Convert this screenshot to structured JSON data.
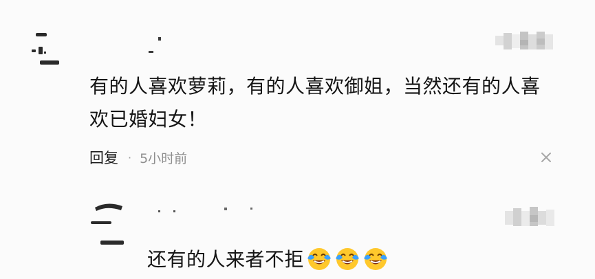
{
  "comments": [
    {
      "text": "有的人喜欢萝莉，有的人喜欢御姐，当然还有的人喜欢已婚妇女！",
      "reply_label": "回复",
      "separator": "·",
      "time": "5小时前"
    },
    {
      "text": "还有的人来者不拒",
      "emojis": [
        "laughing-crying-emoji",
        "laughing-crying-emoji",
        "laughing-crying-emoji"
      ]
    }
  ],
  "icons": {
    "close": "close-icon"
  },
  "colors": {
    "background": "#fbfbfb",
    "text": "#151515",
    "meta": "#8e8e8e",
    "emoji_face": "#ffc82c",
    "emoji_tears": "#3aa0ff"
  }
}
